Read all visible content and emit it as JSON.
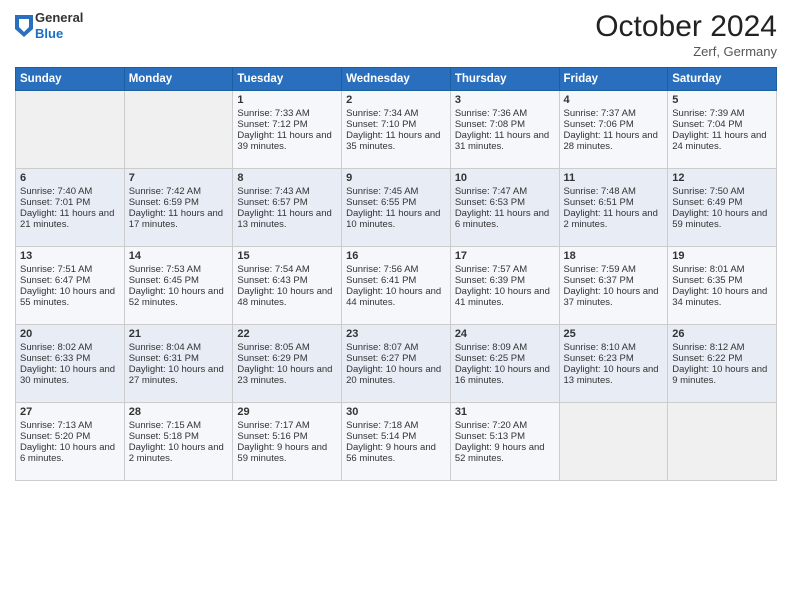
{
  "header": {
    "logo_general": "General",
    "logo_blue": "Blue",
    "title": "October 2024",
    "location": "Zerf, Germany"
  },
  "days_of_week": [
    "Sunday",
    "Monday",
    "Tuesday",
    "Wednesday",
    "Thursday",
    "Friday",
    "Saturday"
  ],
  "weeks": [
    [
      {
        "day": "",
        "empty": true
      },
      {
        "day": "",
        "empty": true
      },
      {
        "day": "1",
        "sunrise": "Sunrise: 7:33 AM",
        "sunset": "Sunset: 7:12 PM",
        "daylight": "Daylight: 11 hours and 39 minutes."
      },
      {
        "day": "2",
        "sunrise": "Sunrise: 7:34 AM",
        "sunset": "Sunset: 7:10 PM",
        "daylight": "Daylight: 11 hours and 35 minutes."
      },
      {
        "day": "3",
        "sunrise": "Sunrise: 7:36 AM",
        "sunset": "Sunset: 7:08 PM",
        "daylight": "Daylight: 11 hours and 31 minutes."
      },
      {
        "day": "4",
        "sunrise": "Sunrise: 7:37 AM",
        "sunset": "Sunset: 7:06 PM",
        "daylight": "Daylight: 11 hours and 28 minutes."
      },
      {
        "day": "5",
        "sunrise": "Sunrise: 7:39 AM",
        "sunset": "Sunset: 7:04 PM",
        "daylight": "Daylight: 11 hours and 24 minutes."
      }
    ],
    [
      {
        "day": "6",
        "sunrise": "Sunrise: 7:40 AM",
        "sunset": "Sunset: 7:01 PM",
        "daylight": "Daylight: 11 hours and 21 minutes."
      },
      {
        "day": "7",
        "sunrise": "Sunrise: 7:42 AM",
        "sunset": "Sunset: 6:59 PM",
        "daylight": "Daylight: 11 hours and 17 minutes."
      },
      {
        "day": "8",
        "sunrise": "Sunrise: 7:43 AM",
        "sunset": "Sunset: 6:57 PM",
        "daylight": "Daylight: 11 hours and 13 minutes."
      },
      {
        "day": "9",
        "sunrise": "Sunrise: 7:45 AM",
        "sunset": "Sunset: 6:55 PM",
        "daylight": "Daylight: 11 hours and 10 minutes."
      },
      {
        "day": "10",
        "sunrise": "Sunrise: 7:47 AM",
        "sunset": "Sunset: 6:53 PM",
        "daylight": "Daylight: 11 hours and 6 minutes."
      },
      {
        "day": "11",
        "sunrise": "Sunrise: 7:48 AM",
        "sunset": "Sunset: 6:51 PM",
        "daylight": "Daylight: 11 hours and 2 minutes."
      },
      {
        "day": "12",
        "sunrise": "Sunrise: 7:50 AM",
        "sunset": "Sunset: 6:49 PM",
        "daylight": "Daylight: 10 hours and 59 minutes."
      }
    ],
    [
      {
        "day": "13",
        "sunrise": "Sunrise: 7:51 AM",
        "sunset": "Sunset: 6:47 PM",
        "daylight": "Daylight: 10 hours and 55 minutes."
      },
      {
        "day": "14",
        "sunrise": "Sunrise: 7:53 AM",
        "sunset": "Sunset: 6:45 PM",
        "daylight": "Daylight: 10 hours and 52 minutes."
      },
      {
        "day": "15",
        "sunrise": "Sunrise: 7:54 AM",
        "sunset": "Sunset: 6:43 PM",
        "daylight": "Daylight: 10 hours and 48 minutes."
      },
      {
        "day": "16",
        "sunrise": "Sunrise: 7:56 AM",
        "sunset": "Sunset: 6:41 PM",
        "daylight": "Daylight: 10 hours and 44 minutes."
      },
      {
        "day": "17",
        "sunrise": "Sunrise: 7:57 AM",
        "sunset": "Sunset: 6:39 PM",
        "daylight": "Daylight: 10 hours and 41 minutes."
      },
      {
        "day": "18",
        "sunrise": "Sunrise: 7:59 AM",
        "sunset": "Sunset: 6:37 PM",
        "daylight": "Daylight: 10 hours and 37 minutes."
      },
      {
        "day": "19",
        "sunrise": "Sunrise: 8:01 AM",
        "sunset": "Sunset: 6:35 PM",
        "daylight": "Daylight: 10 hours and 34 minutes."
      }
    ],
    [
      {
        "day": "20",
        "sunrise": "Sunrise: 8:02 AM",
        "sunset": "Sunset: 6:33 PM",
        "daylight": "Daylight: 10 hours and 30 minutes."
      },
      {
        "day": "21",
        "sunrise": "Sunrise: 8:04 AM",
        "sunset": "Sunset: 6:31 PM",
        "daylight": "Daylight: 10 hours and 27 minutes."
      },
      {
        "day": "22",
        "sunrise": "Sunrise: 8:05 AM",
        "sunset": "Sunset: 6:29 PM",
        "daylight": "Daylight: 10 hours and 23 minutes."
      },
      {
        "day": "23",
        "sunrise": "Sunrise: 8:07 AM",
        "sunset": "Sunset: 6:27 PM",
        "daylight": "Daylight: 10 hours and 20 minutes."
      },
      {
        "day": "24",
        "sunrise": "Sunrise: 8:09 AM",
        "sunset": "Sunset: 6:25 PM",
        "daylight": "Daylight: 10 hours and 16 minutes."
      },
      {
        "day": "25",
        "sunrise": "Sunrise: 8:10 AM",
        "sunset": "Sunset: 6:23 PM",
        "daylight": "Daylight: 10 hours and 13 minutes."
      },
      {
        "day": "26",
        "sunrise": "Sunrise: 8:12 AM",
        "sunset": "Sunset: 6:22 PM",
        "daylight": "Daylight: 10 hours and 9 minutes."
      }
    ],
    [
      {
        "day": "27",
        "sunrise": "Sunrise: 7:13 AM",
        "sunset": "Sunset: 5:20 PM",
        "daylight": "Daylight: 10 hours and 6 minutes."
      },
      {
        "day": "28",
        "sunrise": "Sunrise: 7:15 AM",
        "sunset": "Sunset: 5:18 PM",
        "daylight": "Daylight: 10 hours and 2 minutes."
      },
      {
        "day": "29",
        "sunrise": "Sunrise: 7:17 AM",
        "sunset": "Sunset: 5:16 PM",
        "daylight": "Daylight: 9 hours and 59 minutes."
      },
      {
        "day": "30",
        "sunrise": "Sunrise: 7:18 AM",
        "sunset": "Sunset: 5:14 PM",
        "daylight": "Daylight: 9 hours and 56 minutes."
      },
      {
        "day": "31",
        "sunrise": "Sunrise: 7:20 AM",
        "sunset": "Sunset: 5:13 PM",
        "daylight": "Daylight: 9 hours and 52 minutes."
      },
      {
        "day": "",
        "empty": true
      },
      {
        "day": "",
        "empty": true
      }
    ]
  ]
}
